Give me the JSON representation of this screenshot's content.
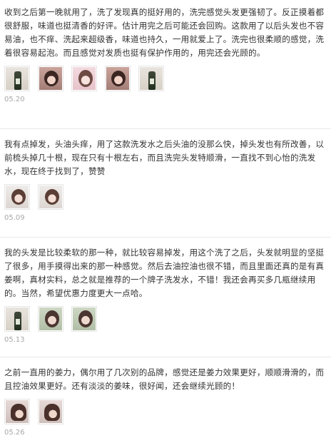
{
  "reviews": [
    {
      "text": "收到之后第一晚就用了，洗了发现真的挺好用的，洗完感觉头发更强韧了。反正摸着都很舒服，味道也挺清香的好评。估计用完之后可能还会回购。这款用了以后头发也不容易油，也不痒、洗起来超级香，味道也持久，一用就爱上了。洗完也很柔顺的感觉，洗着很容易起泡。而且感觉对发质也挺有保护作用的，用完还会光顾的。",
      "date": "05.20",
      "images": [
        "product-bottle-photo",
        "woman-photo",
        "woman-photo",
        "woman-photo",
        "product-bottle-photo"
      ]
    },
    {
      "text": "我有点掉发，头油头痒，用了这款洗发水之后头油的没那么快，掉头发也有所改善，以前梳头掉几十根，现在只有十根左右，而且洗完头发特顺滑，一直找不到心怡的洗发水，现在终于找到了，赞赞",
      "date": "05.09",
      "images": [
        "woman-photo",
        "woman-photo"
      ]
    },
    {
      "text": "我的头发是比较柔软的那一种，就比较容易掉发，用这个洗了之后，头发就明显的坚挺了很多，用手摸得出来的那一种感觉。然后去油控油也很不错，而且里面还真的是有真姜啊，真材实料，总之就是推荐的一个牌子洗发水，不错！我还会再买多几瓶继续用的。当然，希望优惠力度更大一点哈。",
      "date": "05.13",
      "images": [
        "product-bottle-photo",
        "woman-photo",
        "woman-photo"
      ]
    },
    {
      "text": "之前一直用的姜力，偶尔用了几次别的品牌，感觉还是姜力效果更好，顺顺滑滑的，而且控油效果更好。还有淡淡的姜味，很好闻，还会继续光顾的！",
      "date": "05.26",
      "images": [
        "woman-photo",
        "woman-photo"
      ]
    }
  ]
}
